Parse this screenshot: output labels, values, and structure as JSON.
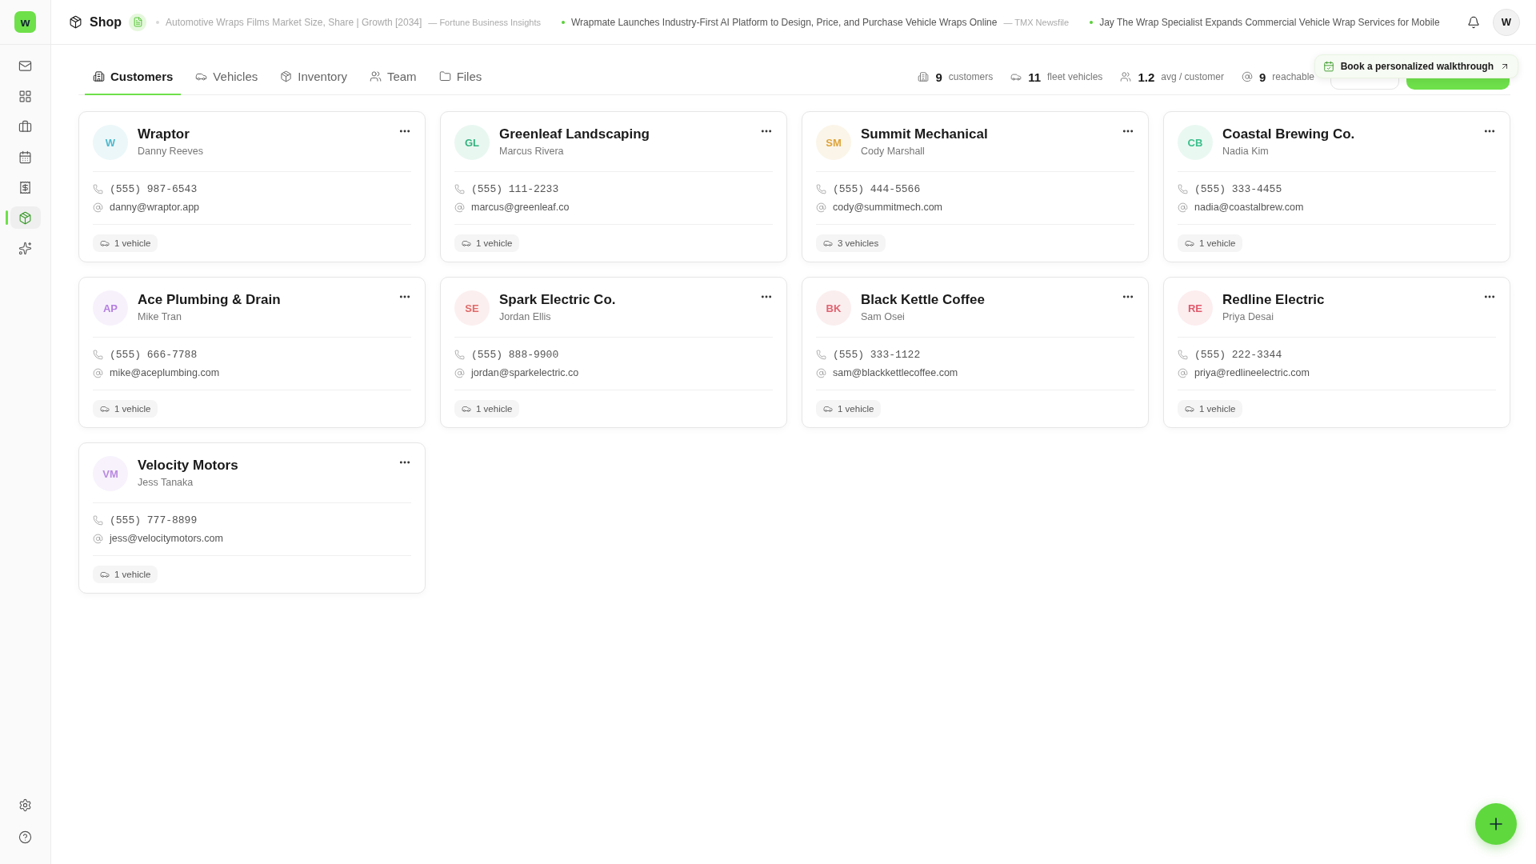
{
  "app": {
    "logo": "w"
  },
  "sidebar": {
    "items": [
      {
        "selected": false
      },
      {
        "selected": false
      },
      {
        "selected": false
      },
      {
        "selected": false
      },
      {
        "selected": false
      },
      {
        "selected": true
      },
      {
        "selected": false
      }
    ]
  },
  "topbar": {
    "title": "Shop",
    "news": [
      {
        "headline": "Automotive Wraps Films Market Size, Share | Growth [2034]",
        "source": "— Fortune Business Insights",
        "faded": true
      },
      {
        "headline": "Wrapmate Launches Industry-First AI Platform to Design, Price, and Purchase Vehicle Wraps Online",
        "source": "— TMX Newsfile",
        "faded": false
      },
      {
        "headline": "Jay The Wrap Specialist Expands Commercial Vehicle Wrap Services for Mobile",
        "faded": false
      }
    ],
    "avatar": "W"
  },
  "tabs": [
    {
      "label": "Customers",
      "selected": true
    },
    {
      "label": "Vehicles",
      "selected": false
    },
    {
      "label": "Inventory",
      "selected": false
    },
    {
      "label": "Team",
      "selected": false
    },
    {
      "label": "Files",
      "selected": false
    }
  ],
  "stats": [
    {
      "value": "9",
      "label": "customers"
    },
    {
      "value": "11",
      "label": "fleet vehicles"
    },
    {
      "value": "1.2",
      "label": "avg / customer"
    },
    {
      "value": "9",
      "label": "reachable"
    }
  ],
  "toast": {
    "text": "Book a personalized walkthrough"
  },
  "customers": [
    {
      "initials": "W",
      "color": "#4fb8cc",
      "name": "Wraptor",
      "contact": "Danny Reeves",
      "phone": "(555) 987-6543",
      "email": "danny@wraptor.app",
      "vehicles": "1 vehicle"
    },
    {
      "initials": "GL",
      "color": "#34b27f",
      "name": "Greenleaf Landscaping",
      "contact": "Marcus Rivera",
      "phone": "(555) 111-2233",
      "email": "marcus@greenleaf.co",
      "vehicles": "1 vehicle"
    },
    {
      "initials": "SM",
      "color": "#dea43a",
      "name": "Summit Mechanical",
      "contact": "Cody Marshall",
      "phone": "(555) 444-5566",
      "email": "cody@summitmech.com",
      "vehicles": "3 vehicles"
    },
    {
      "initials": "CB",
      "color": "#3cbf8c",
      "name": "Coastal Brewing Co.",
      "contact": "Nadia Kim",
      "phone": "(555) 333-4455",
      "email": "nadia@coastalbrew.com",
      "vehicles": "1 vehicle"
    },
    {
      "initials": "AP",
      "color": "#b47ee0",
      "name": "Ace Plumbing & Drain",
      "contact": "Mike Tran",
      "phone": "(555) 666-7788",
      "email": "mike@aceplumbing.com",
      "vehicles": "1 vehicle"
    },
    {
      "initials": "SE",
      "color": "#e06a6a",
      "name": "Spark Electric Co.",
      "contact": "Jordan Ellis",
      "phone": "(555) 888-9900",
      "email": "jordan@sparkelectric.co",
      "vehicles": "1 vehicle"
    },
    {
      "initials": "BK",
      "color": "#df6470",
      "name": "Black Kettle Coffee",
      "contact": "Sam Osei",
      "phone": "(555) 333-1122",
      "email": "sam@blackkettlecoffee.com",
      "vehicles": "1 vehicle"
    },
    {
      "initials": "RE",
      "color": "#e05a6b",
      "name": "Redline Electric",
      "contact": "Priya Desai",
      "phone": "(555) 222-3344",
      "email": "priya@redlineelectric.com",
      "vehicles": "1 vehicle"
    },
    {
      "initials": "VM",
      "color": "#b98ae0",
      "name": "Velocity Motors",
      "contact": "Jess Tanaka",
      "phone": "(555) 777-8899",
      "email": "jess@velocitymotors.com",
      "vehicles": "1 vehicle"
    }
  ]
}
